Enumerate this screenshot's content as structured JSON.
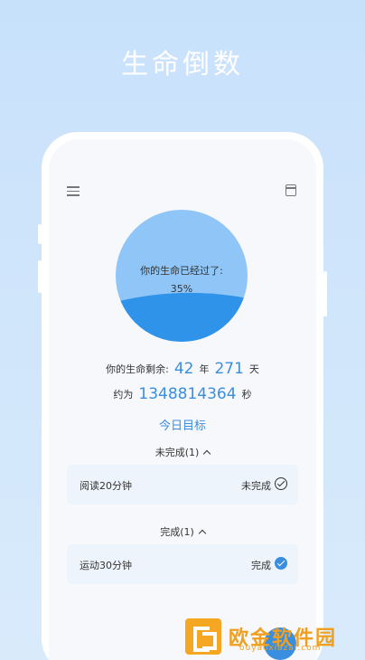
{
  "page": {
    "title": "生命倒数"
  },
  "header": {
    "menu_icon": "menu-icon",
    "calendar_icon": "calendar-icon"
  },
  "life": {
    "label": "你的生命已经过了:",
    "percent_text": "35%",
    "percent": 0.35,
    "remain_label": "你的生命剩余:",
    "years": "42",
    "years_unit": "年",
    "days": "271",
    "days_unit": "天",
    "approx_label": "约为",
    "seconds": "1348814364",
    "seconds_unit": "秒"
  },
  "goals": {
    "title": "今日目标",
    "incomplete_header": "未完成(1)",
    "complete_header": "完成(1)",
    "incomplete_tasks": [
      {
        "name": "阅读20分钟",
        "status": "未完成"
      }
    ],
    "complete_tasks": [
      {
        "name": "运动30分钟",
        "status": "完成"
      }
    ]
  },
  "watermark": {
    "text": "欧金软件园",
    "url": "ouyaoxiazai.com"
  },
  "colors": {
    "accent": "#3a8ee0",
    "circle_light": "#8fc6f7",
    "circle_fill": "#2f93ea"
  }
}
